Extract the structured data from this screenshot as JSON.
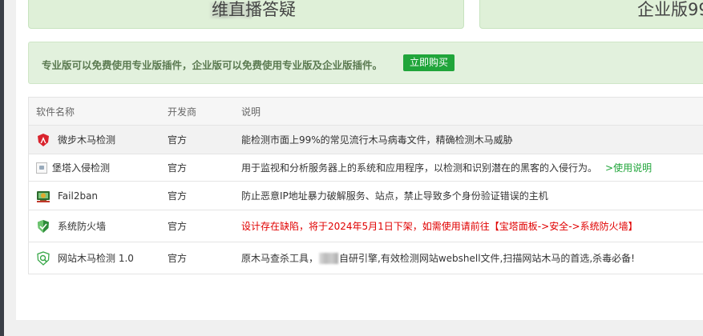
{
  "top_cards": {
    "left_text": "维直播答疑",
    "right_text": "企业版99"
  },
  "notice": {
    "text": "专业版可以免费使用专业版插件，企业版可以免费使用专业版及企业版插件。",
    "buy_label": "立即购买"
  },
  "table": {
    "headers": [
      "软件名称",
      "开发商",
      "说明"
    ],
    "rows": [
      {
        "name": "微步木马检测",
        "icon": "red-shield-icon",
        "dev": "官方",
        "desc": "能检测市面上99%的常见流行木马病毒文件，精确检测木马威胁"
      },
      {
        "name": "堡塔入侵检测",
        "icon": "broken-image-icon",
        "dev": "官方",
        "desc": "用于监视和分析服务器上的系统和应用程序，以检测和识别潜在的黑客的入侵行为。",
        "link": ">使用说明"
      },
      {
        "name": "Fail2ban",
        "icon": "fail2ban-icon",
        "dev": "官方",
        "desc": "防止恶意IP地址暴力破解服务、站点，禁止导致多个身份验证错误的主机"
      },
      {
        "name": "系统防火墙",
        "icon": "green-shield-icon",
        "dev": "官方",
        "desc": "设计存在缺陷，将于2024年5月1日下架，如需使用请前往【宝塔面板->安全->系统防火墙】"
      },
      {
        "name": "网站木马检测 1.0",
        "icon": "scan-shield-icon",
        "dev": "官方",
        "desc_a": "原木马查杀工具，",
        "desc_b": "自研引擎,有效检测网站webshell文件,扫描网站木马的首选,杀毒必备!"
      }
    ]
  },
  "colors": {
    "accent_green": "#20a53a",
    "warning_red": "#e00000",
    "notice_bg": "#e2f1dd"
  }
}
